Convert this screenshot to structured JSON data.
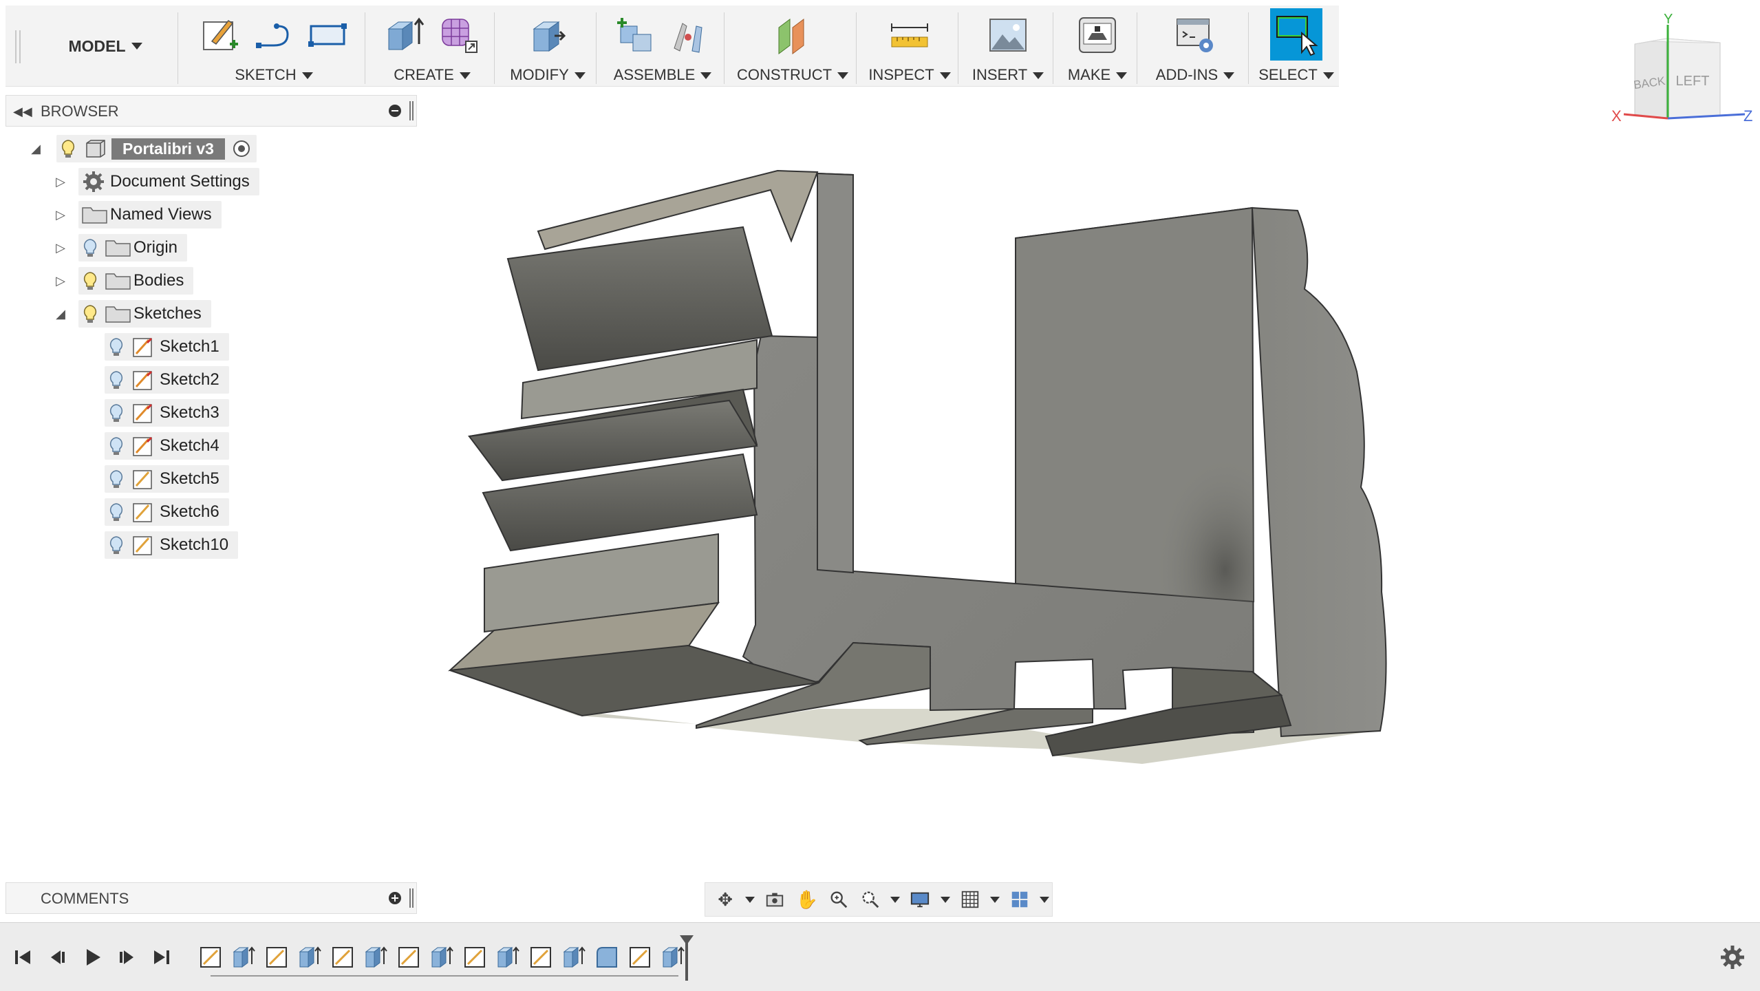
{
  "toolbar": {
    "workspace_label": "MODEL",
    "groups": [
      {
        "label": "SKETCH"
      },
      {
        "label": "CREATE"
      },
      {
        "label": "MODIFY"
      },
      {
        "label": "ASSEMBLE"
      },
      {
        "label": "CONSTRUCT"
      },
      {
        "label": "INSPECT"
      },
      {
        "label": "INSERT"
      },
      {
        "label": "MAKE"
      },
      {
        "label": "ADD-INS"
      },
      {
        "label": "SELECT"
      }
    ],
    "accent_color": "#0696d7"
  },
  "browser": {
    "title": "BROWSER",
    "root": {
      "label": "Portalibri v3"
    },
    "folders": [
      {
        "label": "Document Settings",
        "icon": "gear-icon"
      },
      {
        "label": "Named Views",
        "icon": "folder-icon"
      },
      {
        "label": "Origin",
        "icon": "folder-icon"
      },
      {
        "label": "Bodies",
        "icon": "folder-icon"
      },
      {
        "label": "Sketches",
        "icon": "folder-icon"
      }
    ],
    "sketches": [
      {
        "label": "Sketch1"
      },
      {
        "label": "Sketch2"
      },
      {
        "label": "Sketch3"
      },
      {
        "label": "Sketch4"
      },
      {
        "label": "Sketch5"
      },
      {
        "label": "Sketch6"
      },
      {
        "label": "Sketch10"
      }
    ]
  },
  "comments": {
    "title": "COMMENTS"
  },
  "viewcube": {
    "faces": [
      "BACK",
      "LEFT"
    ],
    "axes": [
      "X",
      "Y",
      "Z"
    ]
  },
  "timeline": {
    "features": [
      "sketch",
      "extrude",
      "sketch",
      "extrude",
      "sketch",
      "extrude",
      "sketch",
      "extrude",
      "sketch",
      "extrude",
      "sketch",
      "extrude",
      "fillet",
      "sketch",
      "extrude"
    ]
  }
}
